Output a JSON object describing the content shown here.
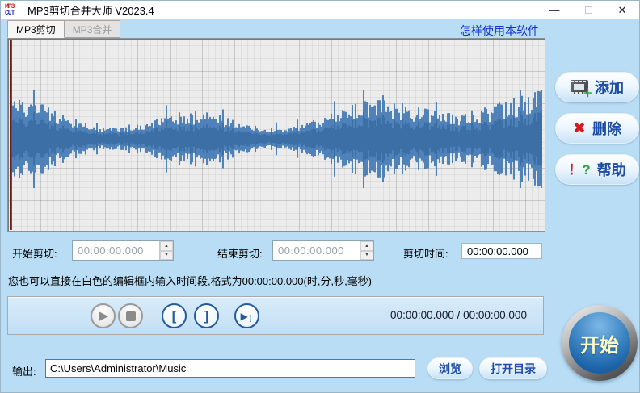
{
  "window": {
    "title": "MP3剪切合并大师 V2023.4",
    "icon_line1": "MP3",
    "icon_line2": "CUT",
    "minimize": "—",
    "close": "✕"
  },
  "tabs": [
    {
      "label": "MP3剪切",
      "active": true
    },
    {
      "label": "MP3合并",
      "active": false
    }
  ],
  "help_link": "怎样使用本软件",
  "side_buttons": [
    {
      "label": "添加"
    },
    {
      "label": "删除"
    },
    {
      "label": "帮助"
    }
  ],
  "cut_controls": {
    "start_label": "开始剪切:",
    "start_value": "00:00:00.000",
    "end_label": "结束剪切:",
    "end_value": "00:00:00.000",
    "duration_label": "剪切时间:",
    "duration_value": "00:00:00.000"
  },
  "hint": "您也可以直接在白色的编辑框内输入时间段,格式为00:00:00.000(时,分,秒,毫秒)",
  "player": {
    "time_display": "00:00:00.000 / 00:00:00.000"
  },
  "start_button_label": "开始",
  "output": {
    "label": "输出:",
    "path": "C:\\Users\\Administrator\\Music",
    "browse_label": "浏览",
    "open_dir_label": "打开目录"
  },
  "colors": {
    "window_bg": "#b9ddf4",
    "waveform": "#4e82b8",
    "playhead": "#a23232",
    "button_text": "#1d4da6",
    "link": "#1330cc",
    "start_button_blue": "#1c63a8"
  }
}
